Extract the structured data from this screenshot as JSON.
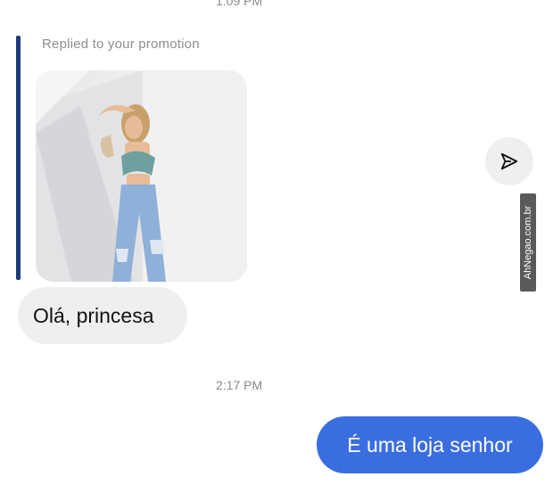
{
  "timestamps": {
    "top": "1:09 PM",
    "middle": "2:17 PM"
  },
  "reply": {
    "label": "Replied to your promotion"
  },
  "messages": {
    "incoming": "Olá, princesa",
    "outgoing": "É uma loja senhor"
  },
  "icons": {
    "share": "send-icon"
  },
  "watermark": "AhNegao.com.br",
  "colors": {
    "outgoing_bubble": "#3a6ee0",
    "incoming_bubble": "#efefef",
    "reply_bar": "#1b3a7a",
    "timestamp": "#8a8a8a"
  }
}
